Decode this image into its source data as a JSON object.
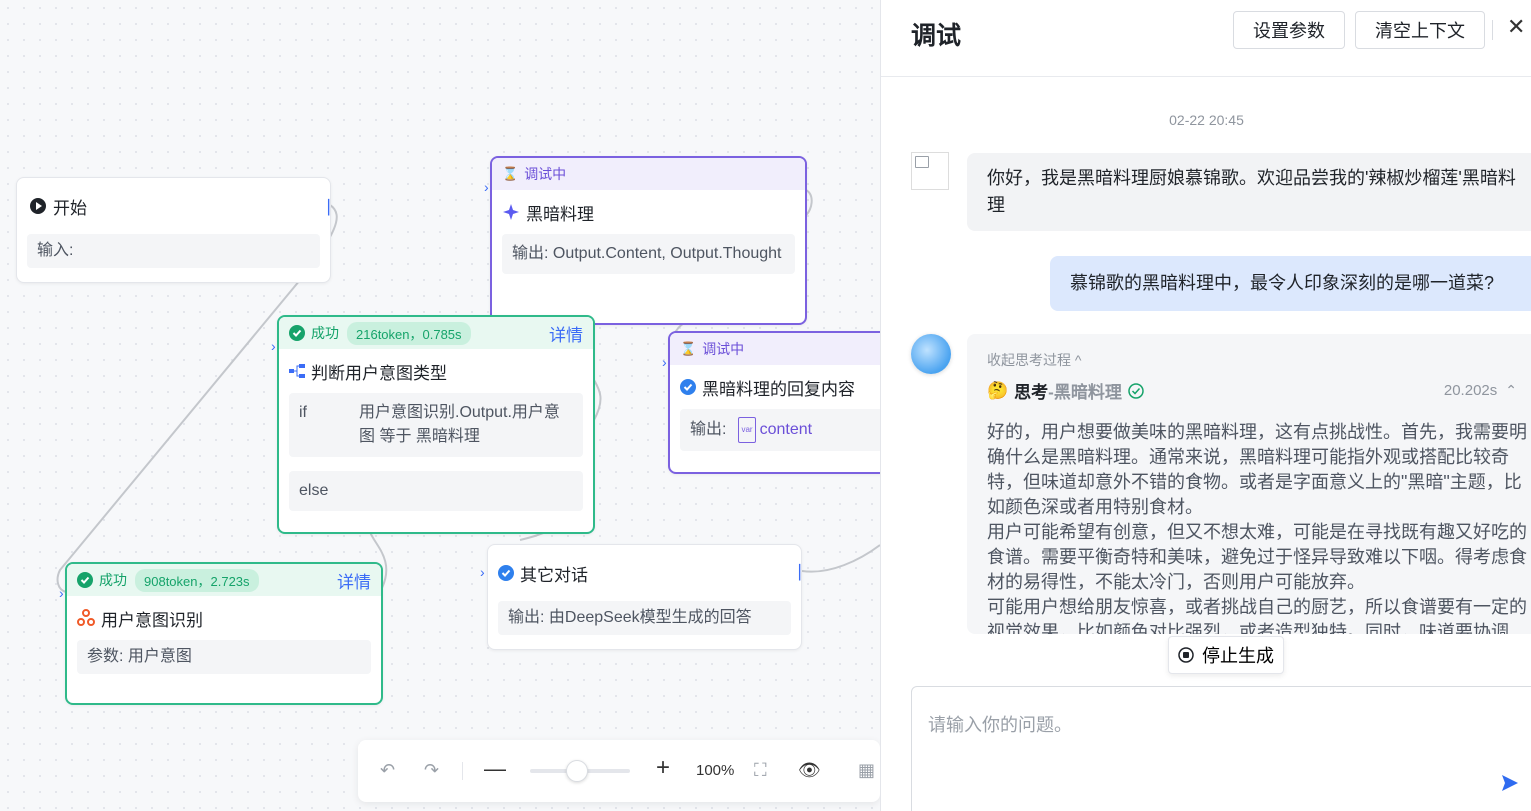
{
  "nodes": {
    "start": {
      "title": "开始",
      "field": "输入:"
    },
    "dark_cooking": {
      "status": "调试中",
      "title": "黑暗料理",
      "output": "输出: Output.Content, Output.Thought"
    },
    "judge": {
      "status": "成功",
      "tokens": "216token，0.785s",
      "detail": "详情",
      "title": "判断用户意图类型",
      "if_label": "if",
      "if_condition": "用户意图识别.Output.用户意图 等于 黑暗料理",
      "else_label": "else"
    },
    "reply": {
      "status": "调试中",
      "title": "黑暗料理的回复内容",
      "output_label": "输出:",
      "output_var": "content"
    },
    "other": {
      "title": "其它对话",
      "output": "输出: 由DeepSeek模型生成的回答"
    },
    "intent": {
      "status": "成功",
      "tokens": "908token，2.723s",
      "detail": "详情",
      "title": "用户意图识别",
      "param": "参数: 用户意图"
    }
  },
  "toolbar": {
    "zoom": "100%"
  },
  "panel": {
    "title": "调试",
    "set_params": "设置参数",
    "clear_context": "清空上下文",
    "timestamp": "02-22 20:45",
    "bot_greeting": "你好，我是黑暗料理厨娘慕锦歌。欢迎品尝我的'辣椒炒榴莲'黑暗料理",
    "user_question": "慕锦歌的黑暗料理中，最令人印象深刻的是哪一道菜?",
    "collapse_thinking": "收起思考过程 ^",
    "think_label": "思考",
    "think_sub": "-黑暗料理",
    "think_time": "20.202s",
    "think_text": "好的，用户想要做美味的黑暗料理，这有点挑战性。首先，我需要明确什么是黑暗料理。通常来说，黑暗料理可能指外观或搭配比较奇特，但味道却意外不错的食物。或者是字面意义上的\"黑暗\"主题，比如颜色深或者用特别食材。\n用户可能希望有创意，但又不想太难，可能是在寻找既有趣又好吃的食谱。需要平衡奇特和美味，避免过于怪异导致难以下咽。得考虑食材的易得性，不能太冷门，否则用户可能放弃。\n可能用户想给朋友惊喜，或者挑战自己的厨艺，所以食谱要有一定的视觉效果，比如颜色对比强烈，或者造型独特。同时，味道要协调",
    "stop_generation": "停止生成",
    "input_placeholder": "请输入你的问题。"
  }
}
